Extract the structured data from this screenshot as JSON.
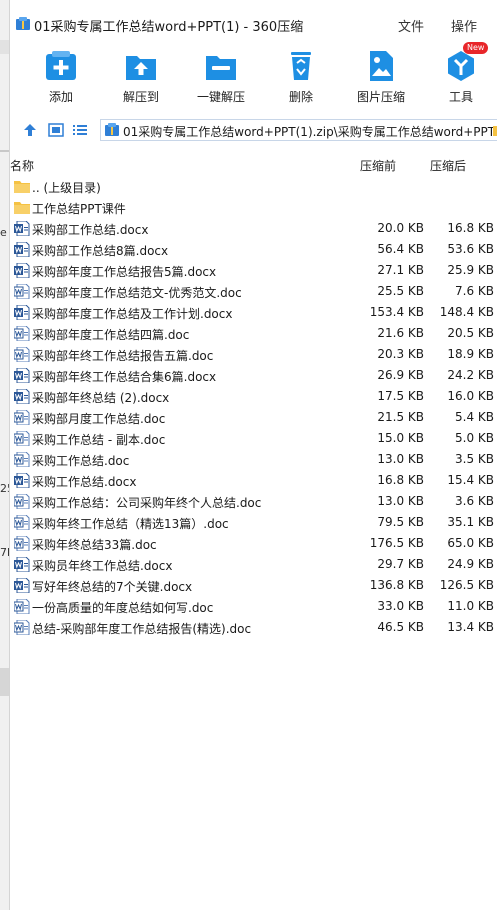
{
  "window": {
    "title": "01采购专属工作总结word+PPT(1) - 360压缩",
    "menu_file": "文件",
    "menu_ops": "操作"
  },
  "background_window": {
    "fragments": [
      "e",
      "25",
      "7b"
    ]
  },
  "toolbar": {
    "add": "添加",
    "extract_to": "解压到",
    "one_click": "一键解压",
    "delete": "删除",
    "image_compress": "图片压缩",
    "tools": "工具",
    "new_badge": "New"
  },
  "address": {
    "path": "01采购专属工作总结word+PPT(1).zip\\采购专属工作总结word+PPT"
  },
  "columns": {
    "name": "名称",
    "before": "压缩前",
    "after": "压缩后"
  },
  "colors": {
    "accent": "#1e8fe3",
    "folder": "#f5c243",
    "word": "#2b5797"
  },
  "files": [
    {
      "name": ".. (上级目录)",
      "type": "folder",
      "before": "",
      "after": ""
    },
    {
      "name": "工作总结PPT课件",
      "type": "folder",
      "before": "",
      "after": ""
    },
    {
      "name": "采购部工作总结.docx",
      "type": "docx",
      "before": "20.0 KB",
      "after": "16.8 KB"
    },
    {
      "name": "采购部工作总结8篇.docx",
      "type": "docx",
      "before": "56.4 KB",
      "after": "53.6 KB"
    },
    {
      "name": "采购部年度工作总结报告5篇.docx",
      "type": "docx",
      "before": "27.1 KB",
      "after": "25.9 KB"
    },
    {
      "name": "采购部年度工作总结范文-优秀范文.doc",
      "type": "doc",
      "before": "25.5 KB",
      "after": "7.6 KB"
    },
    {
      "name": "采购部年度工作总结及工作计划.docx",
      "type": "docx",
      "before": "153.4 KB",
      "after": "148.4 KB"
    },
    {
      "name": "采购部年度工作总结四篇.doc",
      "type": "doc",
      "before": "21.6 KB",
      "after": "20.5 KB"
    },
    {
      "name": "采购部年终工作总结报告五篇.doc",
      "type": "doc",
      "before": "20.3 KB",
      "after": "18.9 KB"
    },
    {
      "name": "采购部年终工作总结合集6篇.docx",
      "type": "docx",
      "before": "26.9 KB",
      "after": "24.2 KB"
    },
    {
      "name": "采购部年终总结 (2).docx",
      "type": "docx",
      "before": "17.5 KB",
      "after": "16.0 KB"
    },
    {
      "name": "采购部月度工作总结.doc",
      "type": "doc",
      "before": "21.5 KB",
      "after": "5.4 KB"
    },
    {
      "name": "采购工作总结 - 副本.doc",
      "type": "doc",
      "before": "15.0 KB",
      "after": "5.0 KB"
    },
    {
      "name": "采购工作总结.doc",
      "type": "doc",
      "before": "13.0 KB",
      "after": "3.5 KB"
    },
    {
      "name": "采购工作总结.docx",
      "type": "docx",
      "before": "16.8 KB",
      "after": "15.4 KB"
    },
    {
      "name": "采购工作总结：公司采购年终个人总结.doc",
      "type": "doc",
      "before": "13.0 KB",
      "after": "3.6 KB"
    },
    {
      "name": "采购年终工作总结（精选13篇）.doc",
      "type": "doc",
      "before": "79.5 KB",
      "after": "35.1 KB"
    },
    {
      "name": "采购年终总结33篇.doc",
      "type": "doc",
      "before": "176.5 KB",
      "after": "65.0 KB"
    },
    {
      "name": "采购员年终工作总结.docx",
      "type": "docx",
      "before": "29.7 KB",
      "after": "24.9 KB"
    },
    {
      "name": "写好年终总结的7个关键.docx",
      "type": "docx",
      "before": "136.8 KB",
      "after": "126.5 KB"
    },
    {
      "name": "一份高质量的年度总结如何写.doc",
      "type": "doc",
      "before": "33.0 KB",
      "after": "11.0 KB"
    },
    {
      "name": "总结-采购部年度工作总结报告(精选).doc",
      "type": "doc",
      "before": "46.5 KB",
      "after": "13.4 KB"
    }
  ]
}
